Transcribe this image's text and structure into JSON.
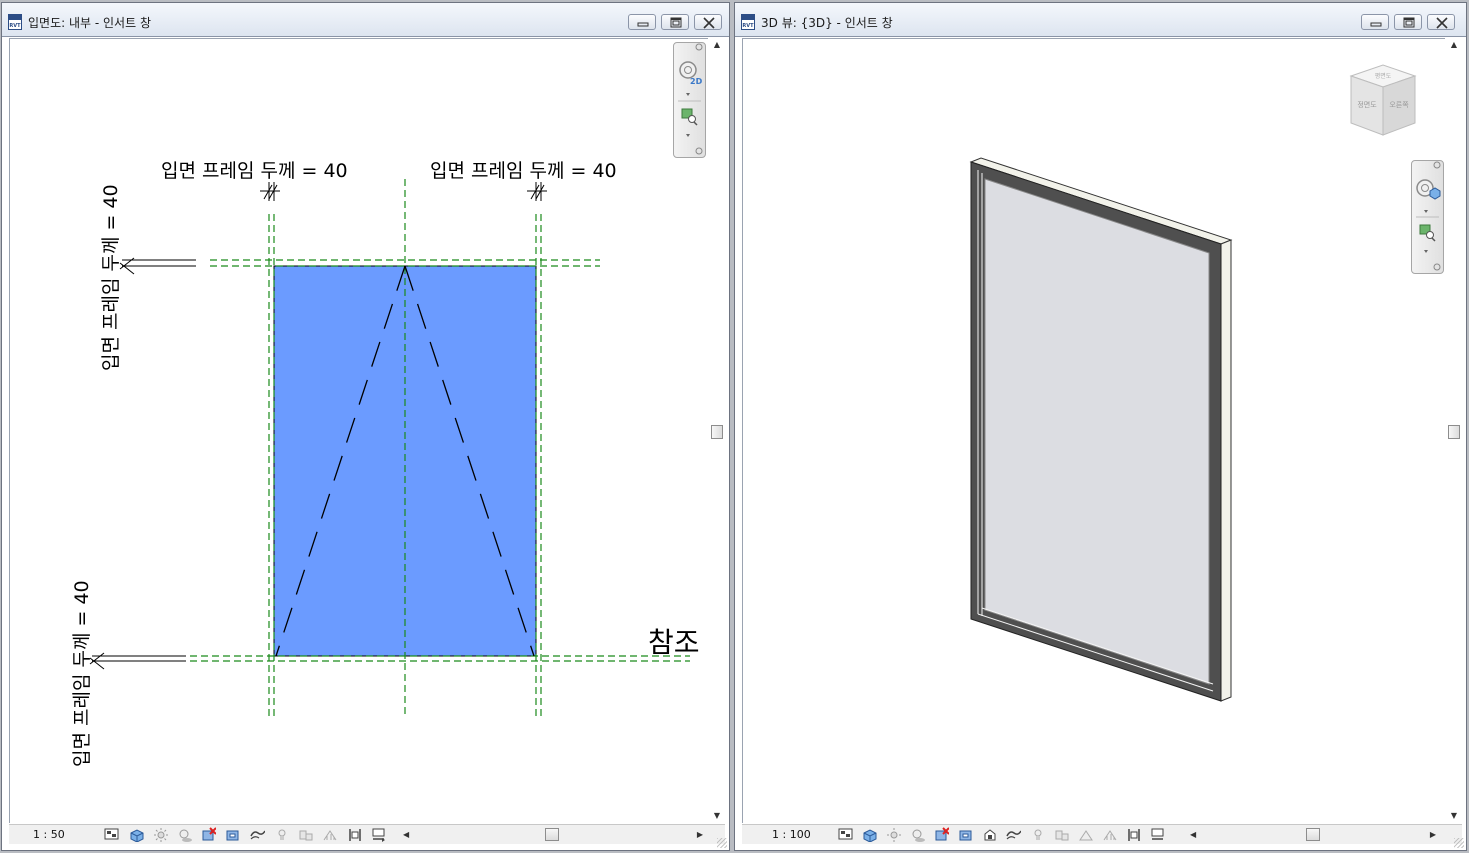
{
  "left_window": {
    "title": "입면도: 내부 - 인서트 창",
    "file_badge": "RVT",
    "scale": "1 : 50",
    "dimension_labels": {
      "top_left": "입면 프레임 두께 = 40",
      "top_right": "입면 프레임 두께 = 40",
      "vertical_upper": "입면 프레임 두께 = 40",
      "vertical_lower": "입면 프레임 두께 = 40"
    },
    "reference_label": "참조",
    "glass_color": "#6b9bff"
  },
  "right_window": {
    "title": "3D 뷰: {3D} - 인서트 창",
    "file_badge": "RVT",
    "scale": "1 : 100",
    "viewcube": {
      "face_front": "정면도",
      "face_right": "오른쪽",
      "face_top": "평면도"
    }
  },
  "colors": {
    "reference_line": "#1a8a1a",
    "frame_dark": "#4f4f4f",
    "frame_light": "#f2f2ea",
    "glass_3d": "#dcdde2"
  },
  "icons": {
    "window_controls": [
      "minimize-icon",
      "restore-icon",
      "close-icon"
    ],
    "status_bar": [
      "detail-level-icon",
      "visual-style-icon",
      "sun-path-icon",
      "shadows-icon",
      "crop-view-icon",
      "show-crop-icon",
      "temporary-hide-icon",
      "reveal-hidden-icon",
      "analysis-icon",
      "constraints-icon",
      "highlight-icon"
    ],
    "nav_bar": [
      "steering-wheel-2d-icon",
      "zoom-region-icon"
    ]
  }
}
